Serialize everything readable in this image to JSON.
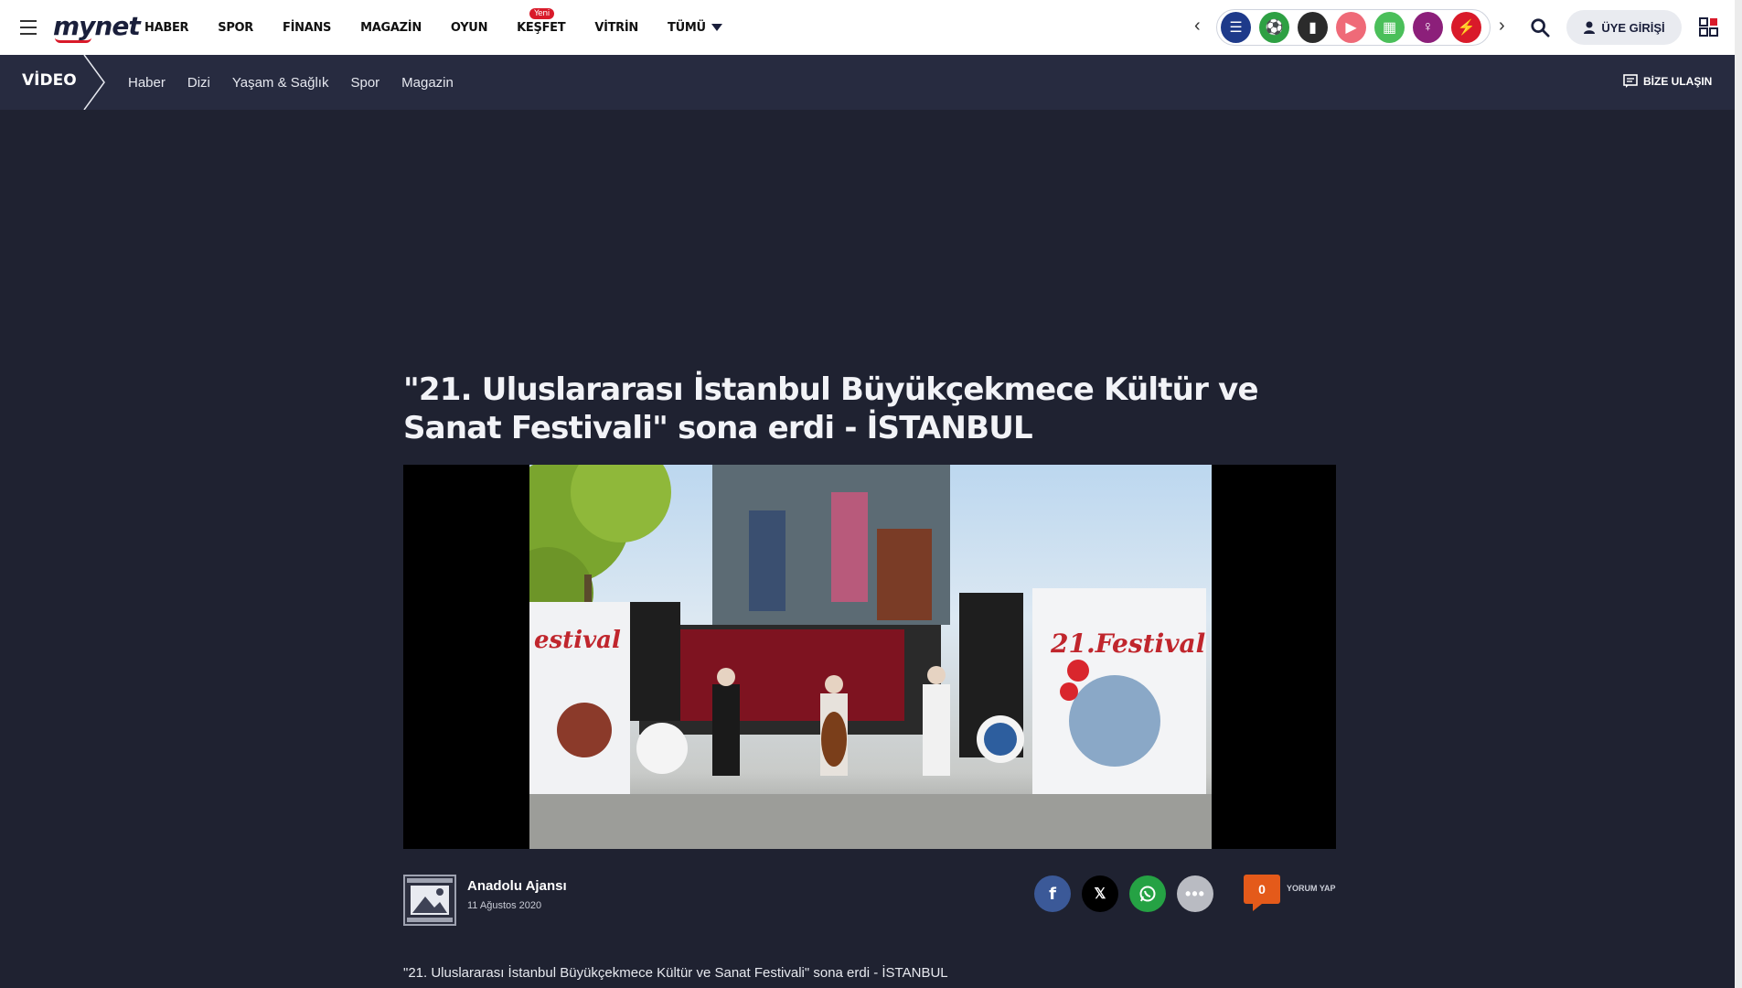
{
  "header": {
    "logo": "mynet",
    "nav": [
      {
        "label": "HABER"
      },
      {
        "label": "SPOR"
      },
      {
        "label": "FİNANS"
      },
      {
        "label": "MAGAZİN"
      },
      {
        "label": "OYUN"
      },
      {
        "label": "KEŞFET",
        "badge": "Yeni"
      },
      {
        "label": "VİTRİN"
      },
      {
        "label": "TÜMÜ"
      }
    ],
    "apps": [
      {
        "icon": "list-icon",
        "color": "#1e3a8a"
      },
      {
        "icon": "soccer-ball-icon",
        "color": "#2ea043"
      },
      {
        "icon": "finance-chart-icon",
        "color": "#2b2b2b"
      },
      {
        "icon": "video-icon",
        "color": "#ef6a78"
      },
      {
        "icon": "puzzle-icon",
        "color": "#4bbf5a"
      },
      {
        "icon": "female-icon",
        "color": "#8c1f7a"
      },
      {
        "icon": "lightning-icon",
        "color": "#d91a2a"
      }
    ],
    "login_label": "ÜYE GİRİŞİ"
  },
  "subnav": {
    "title": "VİDEO",
    "links": [
      "Haber",
      "Dizi",
      "Yaşam & Sağlık",
      "Spor",
      "Magazin"
    ],
    "contact_label": "BİZE ULAŞIN"
  },
  "article": {
    "title": "\"21. Uluslararası İstanbul Büyükçekmece Kültür ve Sanat Festivali\" sona erdi - İSTANBUL",
    "agency": "Anadolu Ajansı",
    "date": "11 Ağustos 2020",
    "comment_count": "0",
    "comment_label": "YORUM YAP",
    "summary": "\"21. Uluslararası İstanbul Büyükçekmece Kültür ve Sanat Festivali\" sona erdi - İSTANBUL"
  },
  "share": [
    {
      "icon": "facebook-icon",
      "color": "#3b5998"
    },
    {
      "icon": "x-icon",
      "color": "#000000"
    },
    {
      "icon": "whatsapp-icon",
      "color": "#25a244"
    },
    {
      "icon": "more-icon",
      "color": "#b9bbc2"
    }
  ]
}
